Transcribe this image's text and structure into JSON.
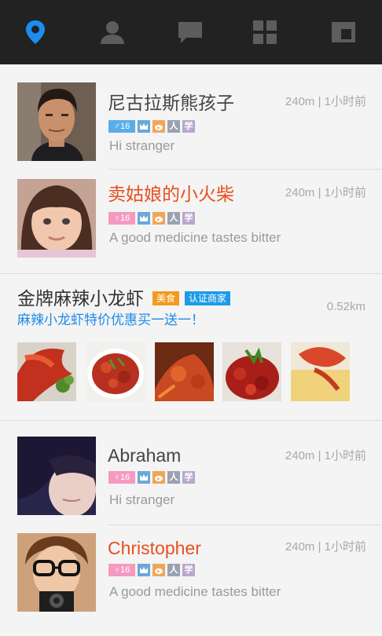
{
  "nav": {
    "tabs": [
      {
        "icon": "location-pin-icon",
        "active": true
      },
      {
        "icon": "person-icon",
        "active": false
      },
      {
        "icon": "chat-bubble-icon",
        "active": false
      },
      {
        "icon": "grid-icon",
        "active": false
      },
      {
        "icon": "window-icon",
        "active": false
      }
    ],
    "active_color": "#1a8ef0",
    "inactive_color": "#5d5d5d",
    "bar_color": "#222222"
  },
  "people": [
    {
      "name": "尼古拉斯熊孩子",
      "name_color": "#444444",
      "distance": "240m",
      "time": "1小时前",
      "meta": "240m | 1小时前",
      "gender_symbol": "♂",
      "age": "16",
      "gender_label": "♂16",
      "gender_color": "#5aaee6",
      "badges": [
        "crown-icon",
        "weibo-icon",
        "人",
        "学"
      ],
      "message": "Hi stranger"
    },
    {
      "name": "卖姑娘的小火柴",
      "name_color": "#e6501e",
      "distance": "240m",
      "time": "1小时前",
      "meta": "240m | 1小时前",
      "gender_symbol": "♀",
      "age": "16",
      "gender_label": "♀16",
      "gender_color": "#f49ac1",
      "badges": [
        "crown-icon",
        "weibo-icon",
        "人",
        "学"
      ],
      "message": "A good medicine tastes bitter"
    },
    {
      "name": "Abraham",
      "name_color": "#444444",
      "distance": "240m",
      "time": "1小时前",
      "meta": "240m | 1小时前",
      "gender_symbol": "♀",
      "age": "16",
      "gender_label": "♀16",
      "gender_color": "#f49ac1",
      "badges": [
        "crown-icon",
        "weibo-icon",
        "人",
        "学"
      ],
      "message": "Hi stranger"
    },
    {
      "name": "Christopher",
      "name_color": "#e6501e",
      "distance": "240m",
      "time": "1小时前",
      "meta": "240m | 1小时前",
      "gender_symbol": "♀",
      "age": "16",
      "gender_label": "♀16",
      "gender_color": "#f49ac1",
      "badges": [
        "crown-icon",
        "weibo-icon",
        "人",
        "学"
      ],
      "message": "A good medicine tastes bitter"
    }
  ],
  "badge_colors": {
    "crown": "#6aa8d8",
    "weibo": "#f0a65a",
    "person": "#9aa2b2",
    "study": "#b9a7cc"
  },
  "badge_text": {
    "person": "人",
    "study": "学"
  },
  "shop": {
    "title": "金牌麻辣小龙虾",
    "tag_food": "美食",
    "tag_food_color": "#f39a1e",
    "tag_certified": "认证商家",
    "tag_certified_color": "#1e9be8",
    "promo": "麻辣小龙虾特价优惠买一送一！",
    "distance": "0.52km",
    "photo_count": 5
  }
}
